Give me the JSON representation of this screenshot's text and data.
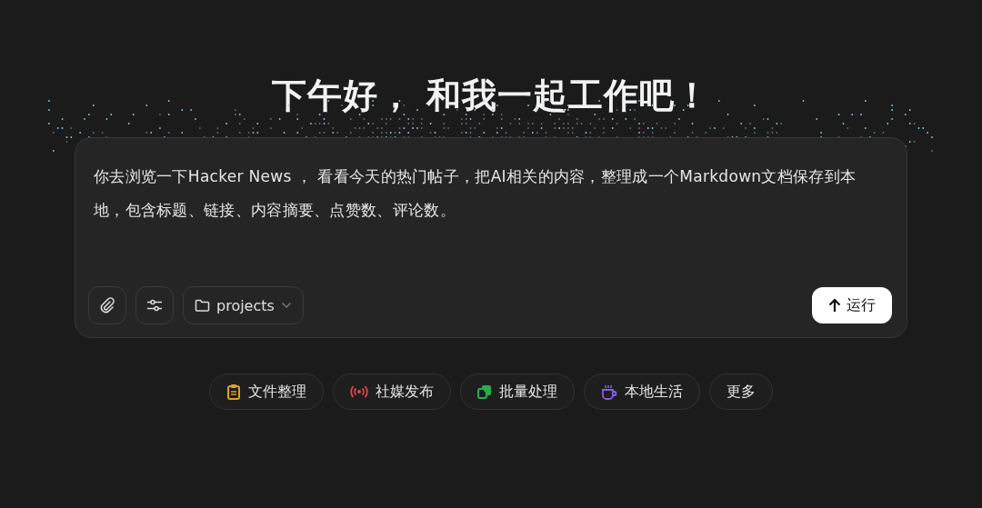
{
  "heading": "下午好， 和我一起工作吧！",
  "prompt": {
    "value": "你去浏览一下Hacker News ， 看看今天的热门帖子，把AI相关的内容，整理成一个Markdown文档保存到本地，包含标题、链接、内容摘要、点赞数、评论数。",
    "folder": "projects",
    "run_label": "运行"
  },
  "chips": [
    {
      "kind": "clipboard",
      "label": "文件整理",
      "color": "#e0a020"
    },
    {
      "kind": "broadcast",
      "label": "社媒发布",
      "color": "#e04848"
    },
    {
      "kind": "copy",
      "label": "批量处理",
      "color": "#22b04a"
    },
    {
      "kind": "cup",
      "label": "本地生活",
      "color": "#8a5cf0"
    },
    {
      "kind": "none",
      "label": "更多"
    }
  ]
}
